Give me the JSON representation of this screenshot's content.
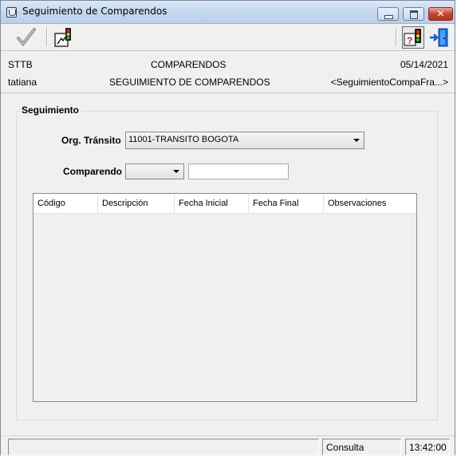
{
  "window": {
    "title": "Seguimiento de Comparendos",
    "icon": "app-icon",
    "close_label": "✕"
  },
  "toolbar": {
    "left_icons": [
      "checkmark-icon",
      "traffic-light-report-icon"
    ],
    "right_icons": [
      "traffic-light-help-icon",
      "exit-door-icon"
    ]
  },
  "info": {
    "company": "STTB",
    "module": "COMPARENDOS",
    "date": "05/14/2021",
    "user": "tatiana",
    "screen_title": "SEGUIMIENTO DE COMPARENDOS",
    "form_name": "<SeguimientoCompaFra...>"
  },
  "form": {
    "group_label": "Seguimiento",
    "org_transito_label": "Org. Tránsito",
    "org_transito_value": "11001-TRANSITO BOGOTA",
    "comparendo_label": "Comparendo",
    "comparendo_type_value": "",
    "comparendo_number_value": ""
  },
  "grid": {
    "columns": [
      "Código",
      "Descripción",
      "Fecha Inicial",
      "Fecha Final",
      "Observaciones"
    ],
    "rows": []
  },
  "status": {
    "message": "",
    "mode": "Consulta",
    "time": "13:42:00"
  }
}
